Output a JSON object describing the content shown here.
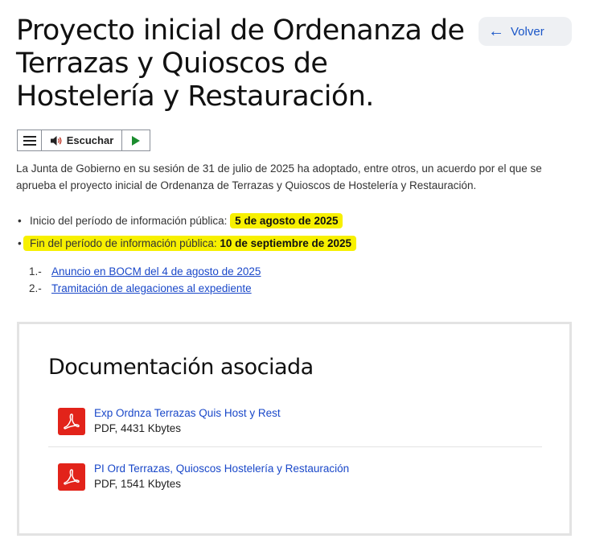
{
  "header": {
    "title": "Proyecto inicial de Ordenanza de Terrazas y Quioscos de Hostelería y Restauración.",
    "back_label": "Volver"
  },
  "player": {
    "listen_label": "Escuchar"
  },
  "intro": "La Junta de Gobierno en su sesión de 31 de julio de 2025 ha adoptado, entre otros, un acuerdo por el que se aprueba el proyecto inicial de Ordenanza de Terrazas y Quioscos de Hostelería y Restauración.",
  "periods": [
    {
      "label": "Inicio del período de información pública:",
      "value": "5 de agosto de 2025"
    },
    {
      "label": "Fin del período de información pública:",
      "value": "10 de septiembre de 2025"
    }
  ],
  "links": [
    {
      "num": "1.-",
      "text_pre": "Anuncio en ",
      "abbr": "BOCM",
      "text_post": " del 4 de agosto de 2025"
    },
    {
      "num": "2.-",
      "text": "Tramitación de alegaciones al expediente"
    }
  ],
  "documents": {
    "title": "Documentación asociada",
    "items": [
      {
        "name": "Exp Ordnza Terrazas Quis Host y Rest",
        "meta": "PDF, 4431 Kbytes"
      },
      {
        "name": "PI Ord Terrazas, Quioscos Hostelería y Restauración",
        "meta": "PDF, 1541 Kbytes"
      }
    ]
  },
  "colors": {
    "highlight": "#f7f000",
    "link": "#1a48c9",
    "pdf_red": "#e2231a"
  }
}
